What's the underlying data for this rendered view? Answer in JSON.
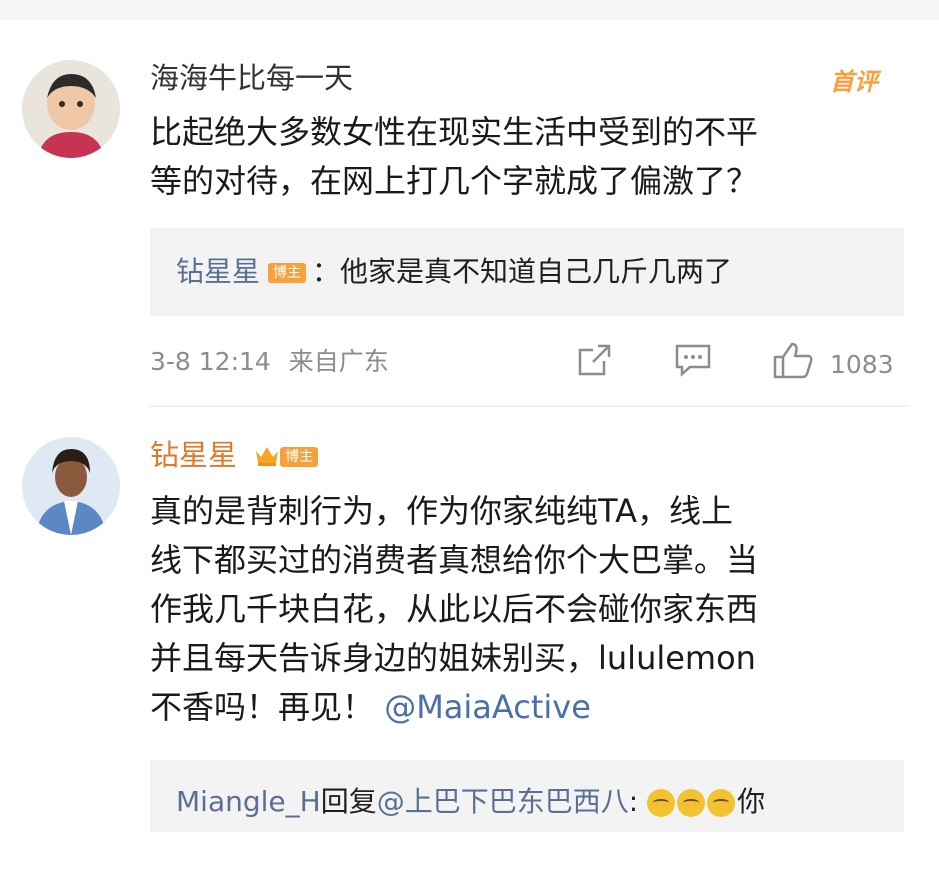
{
  "comments": [
    {
      "username": "海海牛比每一天",
      "tag": "首评",
      "content_line1": "比起绝大多数女性在现实生活中受到的不平",
      "content_line2": "等的对待，在网上打几个字就成了偏激了？",
      "reply": {
        "author": "钻星星",
        "author_badge": "博主",
        "text": "：他家是真不知道自己几斤几两了"
      },
      "time": "3-8 12:14",
      "location": "来自广东",
      "likes": "1083"
    },
    {
      "username": "钻星星",
      "badge": "博主",
      "content_line1": "真的是背刺行为，作为你家纯纯TA，线上",
      "content_line2": "线下都买过的消费者真想给你个大巴掌。当",
      "content_line3": "作我几千块白花，从此以后不会碰你家东西",
      "content_line4": "并且每天告诉身边的姐妹别买，lululemon",
      "content_line5_prefix": "不香吗！再见！",
      "mention": "@MaiaActive",
      "reply": {
        "author": "Miangle_H",
        "connector": "回复",
        "target": "@上巴下巴东巴西八",
        "suffix": ":",
        "tail": "你"
      }
    }
  ],
  "colors": {
    "accent_orange": "#f7a13c",
    "link_blue": "#4a70a8",
    "username_blue": "#5a6f93",
    "meta_gray": "#8c8c8c"
  },
  "icons": [
    "share-icon",
    "comment-icon",
    "like-icon",
    "crown-icon",
    "grin-emoji-icon"
  ]
}
